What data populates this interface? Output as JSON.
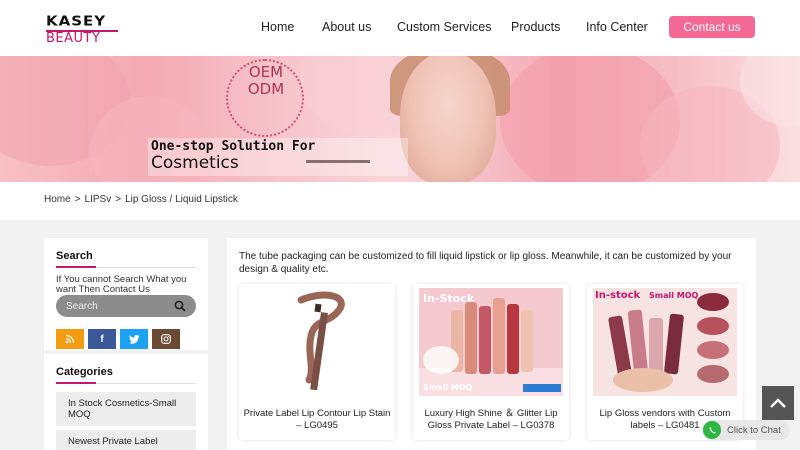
{
  "header": {
    "logo_top": "KASEY",
    "logo_bottom": "BEAUTY",
    "nav": [
      "Home",
      "About us",
      "Custom Services",
      "Products",
      "Info Center"
    ],
    "contact_label": "Contact us"
  },
  "banner": {
    "oem_line1": "OEM",
    "oem_line2": "ODM",
    "slogan_line1": "One-stop Solution For",
    "slogan_line2": "Cosmetics"
  },
  "breadcrumb": [
    "Home",
    "LIPSv",
    "Lip Gloss / Liquid Lipstick"
  ],
  "sidebar": {
    "search_title": "Search",
    "search_desc": "If You cannot Search What you want Then Contact Us",
    "search_placeholder": "Search",
    "social_icons": [
      "rss-icon",
      "facebook-icon",
      "twitter-icon",
      "instagram-icon"
    ],
    "categories_title": "Categories",
    "categories": [
      "In Stock Cosmetics-Small MOQ",
      "Newest Private Label"
    ]
  },
  "main": {
    "intro": "The tube packaging can be customized to fill liquid lipstick or lip gloss. Meanwhile, it can be customized by your design & quality etc.",
    "products": [
      {
        "title": "Private Label Lip Contour Lip Stain – LG0495",
        "badge": "",
        "badge2": ""
      },
      {
        "title": "Luxury High Shine ＆ Glitter Lip Gloss Private Label – LG0378",
        "badge": "In-Stock",
        "badge2": "Small MOQ"
      },
      {
        "title": "Lip Gloss vendors with Custom labels – LG0481",
        "badge": "In-stock",
        "badge2": "Small MOQ"
      }
    ]
  },
  "chat": {
    "label": "Click to Chat"
  },
  "colors": {
    "accent": "#c8166b",
    "contact": "#f36894",
    "whatsapp": "#2db742"
  }
}
